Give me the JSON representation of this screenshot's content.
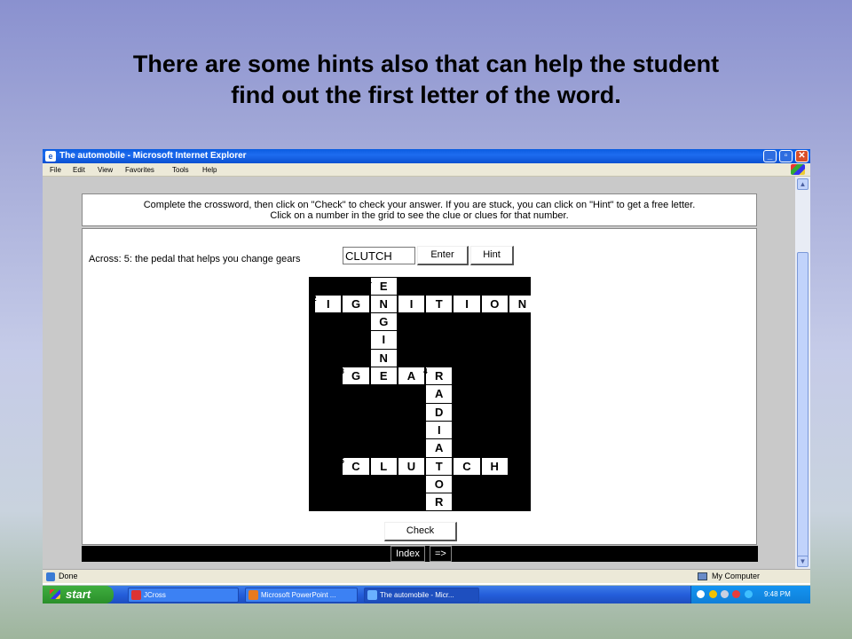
{
  "slide": {
    "title_line1": "There are some hints also that can help the student",
    "title_line2": "find out the first letter of the word."
  },
  "window": {
    "title": "The automobile - Microsoft Internet Explorer",
    "minimize": "_",
    "maximize": "▫",
    "close": "✕"
  },
  "menu": [
    "File",
    "Edit",
    "View",
    "Favorites",
    "Tools",
    "Help"
  ],
  "page": {
    "instructions_line1": "Complete the crossword, then click on \"Check\" to check your answer. If you are stuck, you can click on \"Hint\" to get a free letter.",
    "instructions_line2": "Click on a number in the grid to see the clue or clues for that number.",
    "clue": "Across: 5: the pedal that helps you change gears",
    "answer_value": "CLUTCH",
    "enter_label": "Enter",
    "hint_label": "Hint",
    "check_label": "Check",
    "index_label": "Index",
    "next_label": "=>"
  },
  "crossword": {
    "rows": 13,
    "cols": 8,
    "cells": [
      {
        "r": 0,
        "c": 2,
        "ch": "E",
        "num": "1"
      },
      {
        "r": 1,
        "c": 0,
        "ch": "I",
        "num": "2"
      },
      {
        "r": 1,
        "c": 1,
        "ch": "G"
      },
      {
        "r": 1,
        "c": 2,
        "ch": "N"
      },
      {
        "r": 1,
        "c": 3,
        "ch": "I"
      },
      {
        "r": 1,
        "c": 4,
        "ch": "T"
      },
      {
        "r": 1,
        "c": 5,
        "ch": "I"
      },
      {
        "r": 1,
        "c": 6,
        "ch": "O"
      },
      {
        "r": 1,
        "c": 7,
        "ch": "N"
      },
      {
        "r": 2,
        "c": 2,
        "ch": "G"
      },
      {
        "r": 3,
        "c": 2,
        "ch": "I"
      },
      {
        "r": 4,
        "c": 2,
        "ch": "N"
      },
      {
        "r": 5,
        "c": 1,
        "ch": "G",
        "num": "3"
      },
      {
        "r": 5,
        "c": 2,
        "ch": "E"
      },
      {
        "r": 5,
        "c": 3,
        "ch": "A"
      },
      {
        "r": 5,
        "c": 4,
        "ch": "R",
        "num": "4"
      },
      {
        "r": 6,
        "c": 4,
        "ch": "A"
      },
      {
        "r": 7,
        "c": 4,
        "ch": "D"
      },
      {
        "r": 8,
        "c": 4,
        "ch": "I"
      },
      {
        "r": 9,
        "c": 4,
        "ch": "A"
      },
      {
        "r": 10,
        "c": 1,
        "ch": "C",
        "num": "5"
      },
      {
        "r": 10,
        "c": 2,
        "ch": "L"
      },
      {
        "r": 10,
        "c": 3,
        "ch": "U"
      },
      {
        "r": 10,
        "c": 4,
        "ch": "T"
      },
      {
        "r": 10,
        "c": 5,
        "ch": "C"
      },
      {
        "r": 10,
        "c": 6,
        "ch": "H"
      },
      {
        "r": 11,
        "c": 4,
        "ch": "O"
      },
      {
        "r": 12,
        "c": 4,
        "ch": "R"
      }
    ]
  },
  "status": {
    "left": "Done",
    "zone": "My Computer"
  },
  "taskbar": {
    "start": "start",
    "tasks": [
      "JCross",
      "Microsoft PowerPoint ...",
      "The automobile - Micr..."
    ],
    "clock": "9:48 PM"
  },
  "icons": {
    "ie": "ie-icon",
    "done": "page-done-icon",
    "computer": "my-computer-icon"
  },
  "colors": {
    "titlebar": "#0a5ce0",
    "taskbar": "#245edb",
    "start": "#2a8f2a"
  }
}
